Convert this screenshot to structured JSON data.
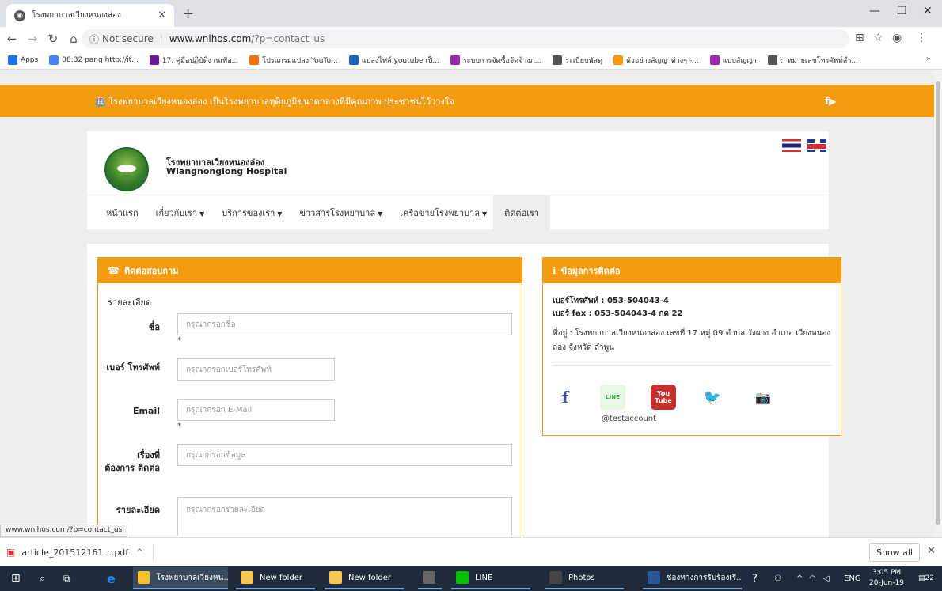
{
  "browser": {
    "tab_title": "โรงพยาบาลเวียงหนองล่อง",
    "url_info": "Not secure",
    "url_host": "www.wnlhos.com",
    "url_path": "/?p=contact_us",
    "bookmarks": [
      {
        "label": "Apps",
        "icon": "apps-grid-icon",
        "color": "#1a73e8"
      },
      {
        "label": "08:32 pang http://it...",
        "icon": "google-icon",
        "color": "#4285f4"
      },
      {
        "label": "17. คู่มือปฏิบัติงานเพื่อ...",
        "icon": "gmail-icon",
        "color": "#6a1b9a"
      },
      {
        "label": "โปรแกรมแปลง YouTu...",
        "icon": "number-3-icon",
        "color": "#ff6f00"
      },
      {
        "label": "แปลงไฟล์ youtube เป็...",
        "icon": "convert-icon",
        "color": "#1565c0"
      },
      {
        "label": "ระบบการจัดซื้อจัดจ้างภ...",
        "icon": "egp-icon",
        "color": "#9c27b0"
      },
      {
        "label": "ระเบียบพัสดุ",
        "icon": "globe-icon",
        "color": "#555555"
      },
      {
        "label": "ตัวอย่างสัญญาต่างๆ -...",
        "icon": "sen-icon",
        "color": "#ff9800"
      },
      {
        "label": "แบบสัญญา",
        "icon": "egp-icon",
        "color": "#9c27b0"
      },
      {
        "label": ":: หมายเลขโทรศัพท์สำ...",
        "icon": "globe-icon",
        "color": "#555555"
      }
    ],
    "status_url": "www.wnlhos.com/?p=contact_us"
  },
  "site": {
    "top_message": "🏥 โรงพยาบาลเวียงหนองล่อง เป็นโรงพยาบาลทุติยภูมิขนาดกลางที่มีคุณภาพ ประชาชนไว้วางใจ",
    "top_social": "f▶",
    "brand_th": "โรงพยาบาลเวียงหนองล่อง",
    "brand_en": "Wiangnonglong Hospital",
    "nav": [
      {
        "label": "หน้าแรก",
        "caret": ""
      },
      {
        "label": "เกี่ยวกับเรา",
        "caret": "▼"
      },
      {
        "label": "บริการของเรา",
        "caret": "▼"
      },
      {
        "label": "ข่าวสารโรงพยาบาล",
        "caret": "▼"
      },
      {
        "label": "เครือข่ายโรงพยาบาล",
        "caret": "▼"
      },
      {
        "label": "ติดต่อเรา",
        "caret": ""
      }
    ]
  },
  "contact_form": {
    "heading": "ติดต่อสอบถาม",
    "section_title": "รายละเอียด",
    "name_label": "ชื่อ",
    "name_placeholder": "กรุณากรอกชื่อ",
    "phone_label": "เบอร์ โทรศัพท์",
    "phone_placeholder": "กรุณากรอกเบอร์โทรศัพท์",
    "email_label": "Email",
    "email_placeholder": "กรุณากรอก E-Mail",
    "subject_label": "เรื่องที่ ต้องการ ติดต่อ",
    "subject_placeholder": "กรุณากรอกข้อมูล",
    "detail_label": "รายละเอียด",
    "detail_placeholder": "กรุณากรอกรายละเอียด",
    "required_mark": "*"
  },
  "contact_info": {
    "heading": "ข้อมูลการติดต่อ",
    "phone": "เบอร์โทรศัพท์ : 053-504043-4",
    "fax": "เบอร์ fax : 053-504043-4 กด 22",
    "address": "ที่อยู่ : โรงพยาบาลเวียงหนองล่อง เลขที่ 17 หมู่ 09 ตำบล วังผาง อำเภอ เวียงหนองล่อง จังหวัด ลำพูน",
    "line_account": "@testaccount",
    "social": {
      "facebook": "f",
      "line": "LINE",
      "youtube_top": "You",
      "youtube_bottom": "Tube",
      "twitter": "🐦",
      "instagram": "📷"
    }
  },
  "downloads": {
    "file": "article_201512161....pdf",
    "show_all": "Show all"
  },
  "taskbar": {
    "apps": [
      {
        "label": "โรงพยาบาลเวียงหน...",
        "icon": "chrome-icon",
        "color": "#fbc02d"
      },
      {
        "label": "New folder",
        "icon": "folder-icon",
        "color": "#f9c74f"
      },
      {
        "label": "New folder",
        "icon": "folder-icon",
        "color": "#f9c74f"
      },
      {
        "label": "",
        "icon": "calculator-icon",
        "color": "#666666"
      },
      {
        "label": "LINE",
        "icon": "line-icon",
        "color": "#00c300"
      },
      {
        "label": "Photos",
        "icon": "photos-icon",
        "color": "#444444"
      },
      {
        "label": "ช่องทางการรับร้องเรี...",
        "icon": "word-icon",
        "color": "#2b579a"
      }
    ],
    "lang": "ENG",
    "time": "3:05 PM",
    "date": "20-Jun-19",
    "notif_count": "22"
  }
}
